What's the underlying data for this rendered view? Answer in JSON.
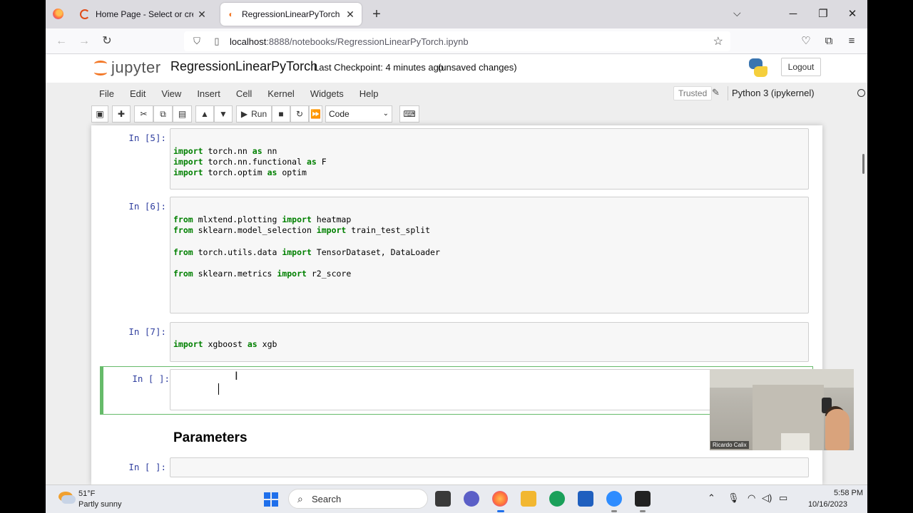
{
  "browser": {
    "tabs": [
      {
        "label": "Home Page - Select or create a notebook",
        "active": false
      },
      {
        "label": "RegressionLinearPyTorch - Jupyter Notebook",
        "active": true
      }
    ],
    "url_host": "localhost",
    "url_rest": ":8888/notebooks/RegressionLinearPyTorch.ipynb"
  },
  "header": {
    "logo_text": "jupyter",
    "notebook_title": "RegressionLinearPyTorch",
    "checkpoint": "Last Checkpoint: 4 minutes ago",
    "unsaved": "(unsaved changes)",
    "logout": "Logout"
  },
  "menu": {
    "items": [
      "File",
      "Edit",
      "View",
      "Insert",
      "Cell",
      "Kernel",
      "Widgets",
      "Help"
    ],
    "trusted": "Trusted",
    "kernel_name": "Python 3 (ipykernel)"
  },
  "toolbar": {
    "run_label": "Run",
    "cell_type": "Code"
  },
  "cells": [
    {
      "prompt": "In [5]:",
      "lines": [
        [
          {
            "t": "import",
            "kw": true
          },
          {
            "t": " torch.nn "
          },
          {
            "t": "as",
            "kw": true
          },
          {
            "t": " nn"
          }
        ],
        [
          {
            "t": "import",
            "kw": true
          },
          {
            "t": " torch.nn.functional "
          },
          {
            "t": "as",
            "kw": true
          },
          {
            "t": " F"
          }
        ],
        [
          {
            "t": "import",
            "kw": true
          },
          {
            "t": " torch.optim "
          },
          {
            "t": "as",
            "kw": true
          },
          {
            "t": " optim"
          }
        ]
      ]
    },
    {
      "prompt": "In [6]:",
      "lines": [
        [
          {
            "t": "from",
            "kw": true
          },
          {
            "t": " mlxtend.plotting "
          },
          {
            "t": "import",
            "kw": true
          },
          {
            "t": " heatmap"
          }
        ],
        [
          {
            "t": "from",
            "kw": true
          },
          {
            "t": " sklearn.model_selection "
          },
          {
            "t": "import",
            "kw": true
          },
          {
            "t": " train_test_split"
          }
        ],
        [],
        [
          {
            "t": "from",
            "kw": true
          },
          {
            "t": " torch.utils.data "
          },
          {
            "t": "import",
            "kw": true
          },
          {
            "t": " TensorDataset, DataLoader"
          }
        ],
        [],
        [
          {
            "t": "from",
            "kw": true
          },
          {
            "t": " sklearn.metrics "
          },
          {
            "t": "import",
            "kw": true
          },
          {
            "t": " r2_score"
          }
        ]
      ]
    },
    {
      "prompt": "In [7]:",
      "lines": [
        [
          {
            "t": "import",
            "kw": true
          },
          {
            "t": " xgboost "
          },
          {
            "t": "as",
            "kw": true
          },
          {
            "t": " xgb"
          }
        ]
      ]
    },
    {
      "prompt": "In [ ]:",
      "lines": []
    },
    {
      "prompt": "In [ ]:",
      "lines": []
    }
  ],
  "markdown_heading": "Parameters",
  "webcam": {
    "name": "Ricardo Calix"
  },
  "taskbar": {
    "temperature": "51°F",
    "weather": "Partly sunny",
    "search_label": "Search",
    "time": "5:58 PM",
    "date": "10/16/2023"
  }
}
